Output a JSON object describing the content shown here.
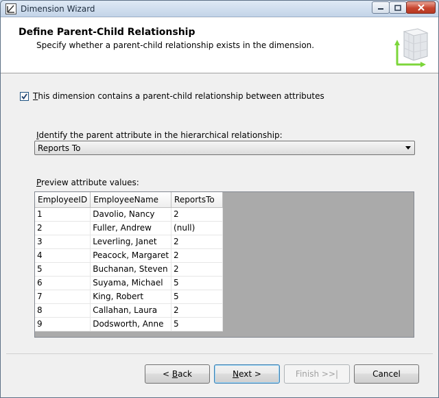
{
  "window": {
    "title": "Dimension Wizard"
  },
  "header": {
    "title": "Define Parent-Child Relationship",
    "subtitle": "Specify whether a parent-child relationship exists in the dimension."
  },
  "parent_child": {
    "checked": true,
    "label_first": "T",
    "label_rest": "his dimension contains a parent-child relationship between attributes"
  },
  "parent_attribute": {
    "label_first": "I",
    "label_rest": "dentify the parent attribute in the hierarchical relationship:",
    "selected": "Reports To"
  },
  "preview": {
    "label_first": "P",
    "label_rest": "review attribute values:",
    "columns": [
      "EmployeeID",
      "EmployeeName",
      "ReportsTo"
    ],
    "rows": [
      [
        "1",
        "Davolio, Nancy",
        "2"
      ],
      [
        "2",
        "Fuller, Andrew",
        "(null)"
      ],
      [
        "3",
        "Leverling, Janet",
        "2"
      ],
      [
        "4",
        "Peacock, Margaret",
        "2"
      ],
      [
        "5",
        "Buchanan, Steven",
        "2"
      ],
      [
        "6",
        "Suyama, Michael",
        "5"
      ],
      [
        "7",
        "King, Robert",
        "5"
      ],
      [
        "8",
        "Callahan, Laura",
        "2"
      ],
      [
        "9",
        "Dodsworth, Anne",
        "5"
      ]
    ]
  },
  "buttons": {
    "back_prefix": "< ",
    "back_key": "B",
    "back_rest": "ack",
    "next_key": "N",
    "next_rest": "ext >",
    "finish": "Finish >>|",
    "cancel": "Cancel"
  },
  "colors": {
    "accent_green": "#7cd63a",
    "grid_background": "#aaaaaa"
  },
  "icons": {
    "window": "wizard-icon",
    "header": "dimension-cube-icon"
  }
}
